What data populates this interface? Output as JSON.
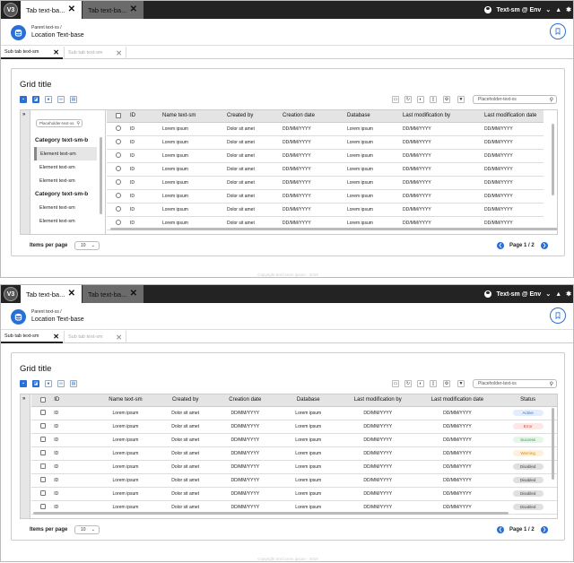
{
  "logo": "V3",
  "window_tabs": [
    {
      "label": "Tab text-ba..."
    },
    {
      "label": "Tab text-ba..."
    }
  ],
  "user": {
    "label": "Text-sm @ Env"
  },
  "header": {
    "parent": "Parent text-xs /",
    "location": "Location Text-base"
  },
  "sub_tabs": [
    {
      "label": "Sub tab text-sm"
    },
    {
      "label": "Sub tab text-sm"
    }
  ],
  "grid": {
    "title": "Grid title",
    "search_placeholder": "Placeholder-text-xs"
  },
  "panel": {
    "search_placeholder": "Placeholder-text-xs",
    "items": [
      {
        "label": "Category text-sm-b",
        "type": "category"
      },
      {
        "label": "Element text-sm",
        "type": "element",
        "selected": true
      },
      {
        "label": "Element text-sm",
        "type": "element"
      },
      {
        "label": "Element text-sm",
        "type": "element"
      },
      {
        "label": "Category text-sm-b",
        "type": "category"
      },
      {
        "label": "Element text-sm",
        "type": "element"
      },
      {
        "label": "Element text-sm",
        "type": "element"
      }
    ]
  },
  "table1": {
    "columns": [
      "ID",
      "Name text-sm",
      "Created by",
      "Creation date",
      "Database",
      "Last modification by",
      "Last modification date"
    ],
    "rows": [
      [
        "ID",
        "Lorem ipsum",
        "Dolor sit amet",
        "DD/MM/YYYY",
        "Lorem ipsum",
        "DD/MM/YYYY",
        "DD/MM/YYYY"
      ],
      [
        "ID",
        "Lorem ipsum",
        "Dolor sit amet",
        "DD/MM/YYYY",
        "Lorem ipsum",
        "DD/MM/YYYY",
        "DD/MM/YYYY"
      ],
      [
        "ID",
        "Lorem ipsum",
        "Dolor sit amet",
        "DD/MM/YYYY",
        "Lorem ipsum",
        "DD/MM/YYYY",
        "DD/MM/YYYY"
      ],
      [
        "ID",
        "Lorem ipsum",
        "Dolor sit amet",
        "DD/MM/YYYY",
        "Lorem ipsum",
        "DD/MM/YYYY",
        "DD/MM/YYYY"
      ],
      [
        "ID",
        "Lorem ipsum",
        "Dolor sit amet",
        "DD/MM/YYYY",
        "Lorem ipsum",
        "DD/MM/YYYY",
        "DD/MM/YYYY"
      ],
      [
        "ID",
        "Lorem ipsum",
        "Dolor sit amet",
        "DD/MM/YYYY",
        "Lorem ipsum",
        "DD/MM/YYYY",
        "DD/MM/YYYY"
      ],
      [
        "ID",
        "Lorem ipsum",
        "Dolor sit amet",
        "DD/MM/YYYY",
        "Lorem ipsum",
        "DD/MM/YYYY",
        "DD/MM/YYYY"
      ],
      [
        "ID",
        "Lorem ipsum",
        "Dolor sit amet",
        "DD/MM/YYYY",
        "Lorem ipsum",
        "DD/MM/YYYY",
        "DD/MM/YYYY"
      ]
    ]
  },
  "table2": {
    "columns": [
      "ID",
      "Name text-sm",
      "Created by",
      "Creation date",
      "Database",
      "Last modification by",
      "Last modification date",
      "Status"
    ],
    "rows": [
      [
        "ID",
        "Lorem ipsum",
        "Dolor sit amet",
        "DD/MM/YYYY",
        "Lorem ipsum",
        "DD/MM/YYYY",
        "DD/MM/YYYY",
        "Active"
      ],
      [
        "ID",
        "Lorem ipsum",
        "Dolor sit amet",
        "DD/MM/YYYY",
        "Lorem ipsum",
        "DD/MM/YYYY",
        "DD/MM/YYYY",
        "Error"
      ],
      [
        "ID",
        "Lorem ipsum",
        "Dolor sit amet",
        "DD/MM/YYYY",
        "Lorem ipsum",
        "DD/MM/YYYY",
        "DD/MM/YYYY",
        "Success"
      ],
      [
        "ID",
        "Lorem ipsum",
        "Dolor sit amet",
        "DD/MM/YYYY",
        "Lorem ipsum",
        "DD/MM/YYYY",
        "DD/MM/YYYY",
        "Warning"
      ],
      [
        "ID",
        "Lorem ipsum",
        "Dolor sit amet",
        "DD/MM/YYYY",
        "Lorem ipsum",
        "DD/MM/YYYY",
        "DD/MM/YYYY",
        "Disabled"
      ],
      [
        "ID",
        "Lorem ipsum",
        "Dolor sit amet",
        "DD/MM/YYYY",
        "Lorem ipsum",
        "DD/MM/YYYY",
        "DD/MM/YYYY",
        "Disabled"
      ],
      [
        "ID",
        "Lorem ipsum",
        "Dolor sit amet",
        "DD/MM/YYYY",
        "Lorem ipsum",
        "DD/MM/YYYY",
        "DD/MM/YYYY",
        "Disabled"
      ],
      [
        "ID",
        "Lorem ipsum",
        "Dolor sit amet",
        "DD/MM/YYYY",
        "Lorem ipsum",
        "DD/MM/YYYY",
        "DD/MM/YYYY",
        "Disabled"
      ]
    ]
  },
  "status_colors": {
    "Active": {
      "bg": "#e3edff",
      "fg": "#2a6fd6"
    },
    "Error": {
      "bg": "#fde8e8",
      "fg": "#d64545"
    },
    "Success": {
      "bg": "#e4f6e8",
      "fg": "#2e9e4c"
    },
    "Warning": {
      "bg": "#fdf0dc",
      "fg": "#d68a1c"
    },
    "Disabled": {
      "bg": "#e0e0e0",
      "fg": "#444444"
    }
  },
  "footer": {
    "items_per_page_label": "Items per page",
    "items_per_page_value": "10",
    "page": "Page 1 / 2"
  },
  "copyright": "Copyright text lorem ipsum - 2019",
  "colors": {
    "accent": "#2a6fd6",
    "topbar": "#232323"
  }
}
